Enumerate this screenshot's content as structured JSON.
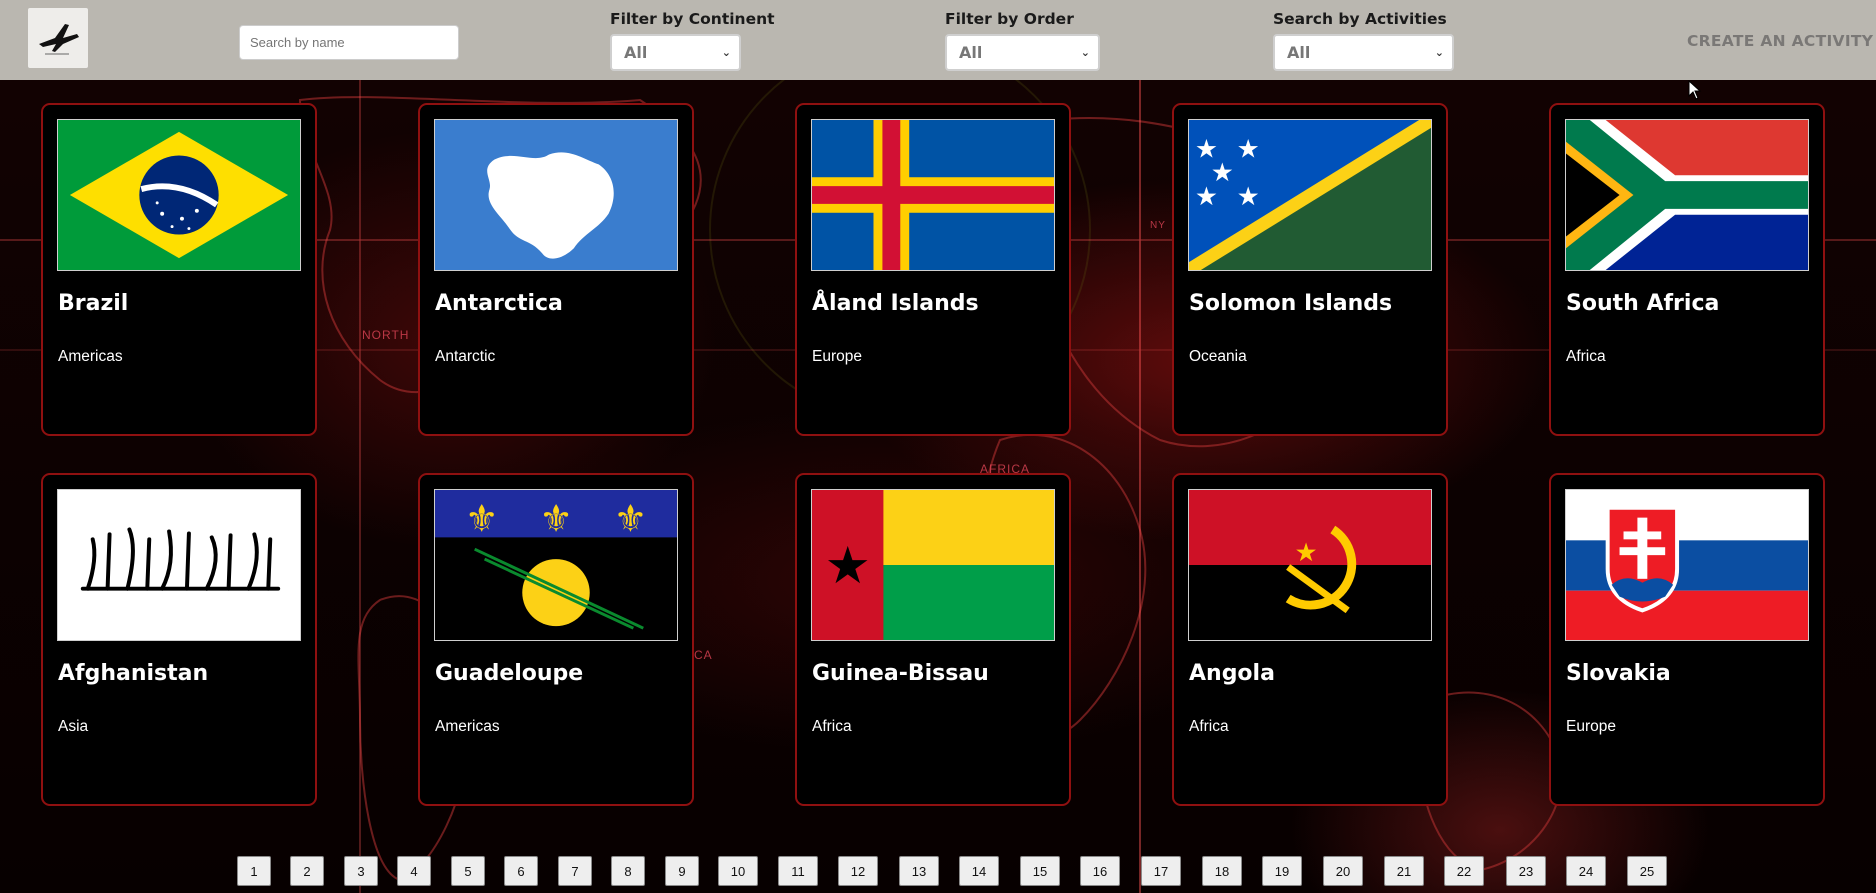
{
  "navbar": {
    "logo_icon": "airplane-icon",
    "search_placeholder": "Search by name",
    "filters": [
      {
        "label": "Filter by Continent",
        "selected": "All"
      },
      {
        "label": "Filter by Order",
        "selected": "All"
      },
      {
        "label": "Search by Activities",
        "selected": "All"
      }
    ],
    "create_label": "CREATE AN ACTIVITY"
  },
  "background_labels": [
    "NORTH",
    "AFRICA",
    "CA",
    "NY"
  ],
  "countries": [
    {
      "name": "Brazil",
      "continent": "Americas",
      "flag": "brazil-flag"
    },
    {
      "name": "Antarctica",
      "continent": "Antarctic",
      "flag": "antarctica-flag"
    },
    {
      "name": "Åland Islands",
      "continent": "Europe",
      "flag": "aland-flag"
    },
    {
      "name": "Solomon Islands",
      "continent": "Oceania",
      "flag": "solomon-flag"
    },
    {
      "name": "South Africa",
      "continent": "Africa",
      "flag": "south-africa-flag"
    },
    {
      "name": "Afghanistan",
      "continent": "Asia",
      "flag": "afghanistan-flag"
    },
    {
      "name": "Guadeloupe",
      "continent": "Americas",
      "flag": "guadeloupe-flag"
    },
    {
      "name": "Guinea-Bissau",
      "continent": "Africa",
      "flag": "guinea-bissau-flag"
    },
    {
      "name": "Angola",
      "continent": "Africa",
      "flag": "angola-flag"
    },
    {
      "name": "Slovakia",
      "continent": "Europe",
      "flag": "slovakia-flag"
    }
  ],
  "pagination": [
    "1",
    "2",
    "3",
    "4",
    "5",
    "6",
    "7",
    "8",
    "9",
    "10",
    "11",
    "12",
    "13",
    "14",
    "15",
    "16",
    "17",
    "18",
    "19",
    "20",
    "21",
    "22",
    "23",
    "24",
    "25"
  ],
  "colors": {
    "navbar_bg": "#bab7b0",
    "card_border": "#8f1010",
    "card_bg": "#000000"
  }
}
